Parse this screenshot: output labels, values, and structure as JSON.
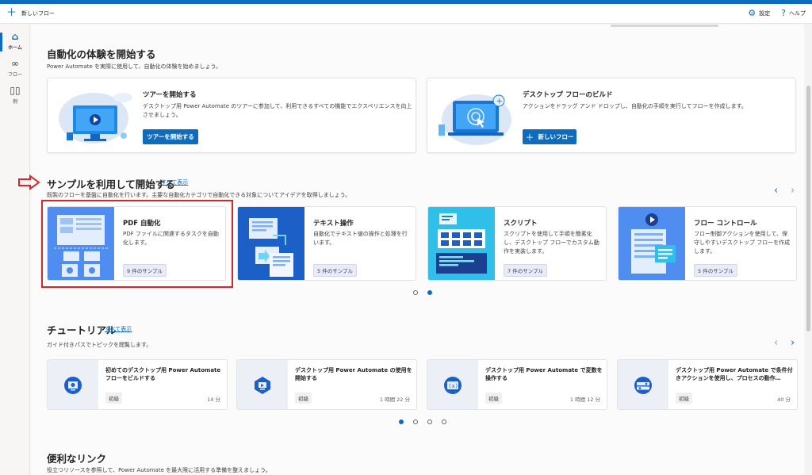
{
  "toolbar": {
    "new_flow_label": "新しいフロー",
    "settings_label": "設定",
    "help_label": "ヘルプ"
  },
  "rail": {
    "items": [
      {
        "label": "ホーム",
        "icon": "home-icon",
        "active": true
      },
      {
        "label": "フロー",
        "icon": "flow-icon",
        "active": false
      },
      {
        "label": "例",
        "icon": "book-icon",
        "active": false
      }
    ]
  },
  "hero": {
    "title": "自動化の体験を開始する",
    "subtitle": "Power Automate を実際に使用して、自動化の体験を始めましょう。",
    "tour": {
      "title": "ツアーを開始する",
      "desc": "デスクトップ用 Power Automate のツアーに参加して、利用できるすべての機能でエクスペリエンスを向上させましょう。",
      "button": "ツアーを開始する"
    },
    "build": {
      "title": "デスクトップ フローのビルド",
      "desc": "アクションをドラッグ アンド ドロップし、自動化の手順を実行してフローを作成します。",
      "button": "新しいフロー"
    }
  },
  "samples": {
    "title": "サンプルを利用して開始する",
    "see_all": "すべて表示",
    "subtitle": "既製のフローを基盤に自動化を行います。主要な自動化カテゴリで自動化できる対象についてアイデアを取得しましょう。",
    "cards": [
      {
        "title": "PDF 自動化",
        "desc": "PDF ファイルに関連するタスクを自動化します。",
        "badge": "9 件のサンプル"
      },
      {
        "title": "テキスト操作",
        "desc": "自動化でテキスト値の操作と処理を行います。",
        "badge": "5 件のサンプル"
      },
      {
        "title": "スクリプト",
        "desc": "スクリプトを使用して手順を簡素化し、デスクトップ フローでカスタム動作を実装します。",
        "badge": "7 件のサンプル"
      },
      {
        "title": "フロー コントロール",
        "desc": "フロー制御アクションを使用して、保守しやすいデスクトップ フローを作成します。",
        "badge": "5 件のサンプル"
      }
    ],
    "page_count": 2,
    "current_page": 2
  },
  "tutorials": {
    "title": "チュートリアル",
    "see_all": "すべて表示",
    "subtitle": "ガイド付きパスでトピックを閲覧します。",
    "cards": [
      {
        "title": "初めてのデスクトップ用 Power Automate フローをビルドする",
        "level": "初級",
        "duration": "14 分",
        "icon": "flow-build-icon"
      },
      {
        "title": "デスクトップ用 Power Automate の使用を開始する",
        "level": "初級",
        "duration": "1 時間 22 分",
        "icon": "rocket-icon"
      },
      {
        "title": "デスクトップ用 Power Automate で変数を操作する",
        "level": "初級",
        "duration": "1 時間 12 分",
        "icon": "variable-icon"
      },
      {
        "title": "デスクトップ用 Power Automate で条件付きアクションを使用し、プロセスの動作…",
        "level": "初級",
        "duration": "40 分",
        "icon": "condition-icon"
      }
    ],
    "page_count": 4,
    "current_page": 1
  },
  "links": {
    "title": "便利なリンク",
    "subtitle": "役立つリソースを参照して、Power Automate を最大限に活用する準備を整えましょう。"
  },
  "colors": {
    "accent": "#0f6cbd",
    "highlight": "#d6262c"
  }
}
